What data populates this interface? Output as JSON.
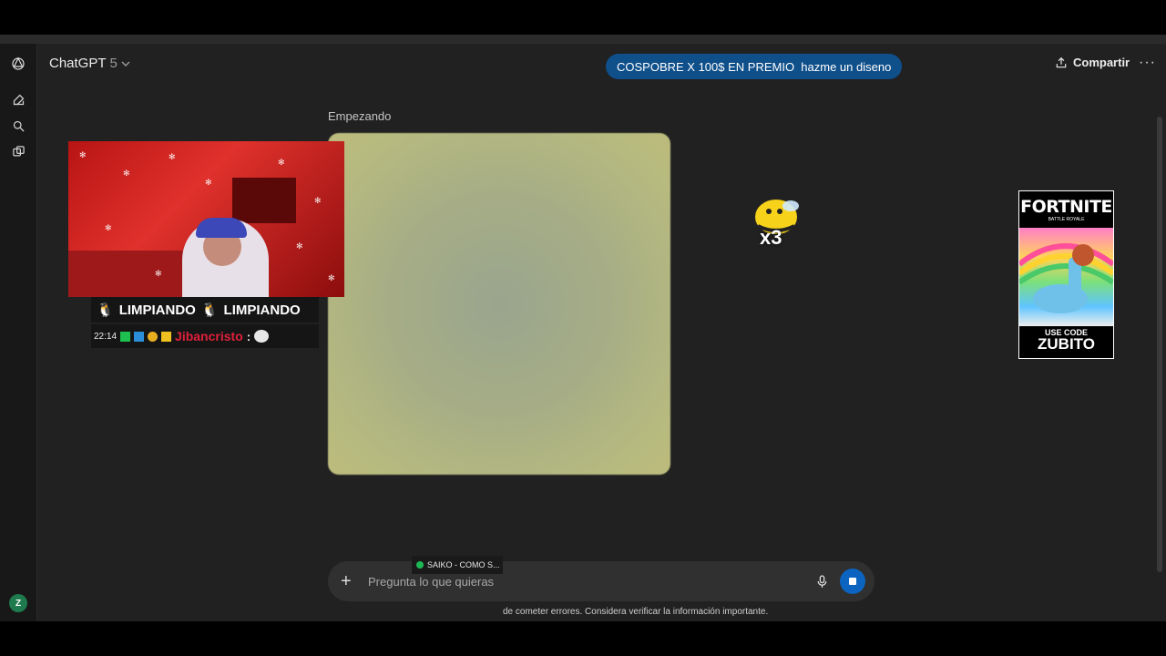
{
  "header": {
    "model_name": "ChatGPT",
    "model_version": "5",
    "banner_text": "COSPOBRE X 100$ EN PREMIO  hazme un diseno",
    "share_label": "Compartir",
    "more_label": "···"
  },
  "sidebar": {
    "icons": [
      "openai-logo-icon",
      "new-chat-icon",
      "search-icon",
      "library-icon"
    ],
    "avatar_initial": "Z"
  },
  "main": {
    "status_label": "Empezando"
  },
  "stream_overlay": {
    "banner_text_1": "LIMPIANDO",
    "banner_text_2": "LIMPIANDO",
    "chat_time": "22:14",
    "chat_user": "Jibancristo",
    "chat_separator": ":",
    "bee_multiplier": "x3",
    "poster_title": "FORTNITE",
    "poster_subtitle": "BATTLE ROYALE",
    "poster_code_label": "USE CODE",
    "poster_code": "ZUBITO",
    "now_playing": "SAIKO - COMO S..."
  },
  "composer": {
    "placeholder": "Pregunta lo que quieras",
    "value": ""
  },
  "footer": {
    "disclaimer": "de cometer errores. Considera verificar la información importante."
  },
  "colors": {
    "background": "#212121",
    "banner": "#0f4f8a",
    "stop_button": "#0b64c0",
    "chat_user": "#e0203a"
  }
}
